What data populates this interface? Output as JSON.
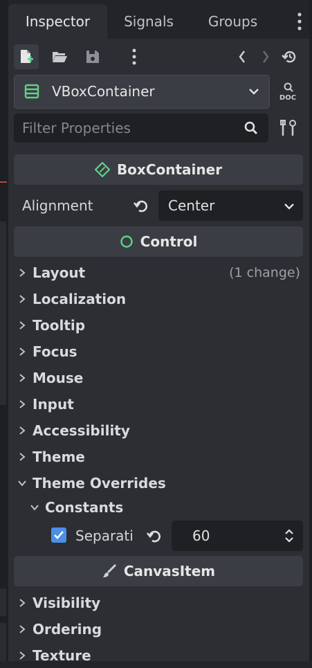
{
  "tabs": [
    {
      "label": "Inspector",
      "active": true
    },
    {
      "label": "Signals",
      "active": false
    },
    {
      "label": "Groups",
      "active": false
    }
  ],
  "toolbar": {
    "icons": [
      "new-resource-icon",
      "open-folder-icon",
      "save-icon",
      "more-vertical-icon",
      "history-back-icon",
      "history-forward-icon",
      "object-history-icon"
    ]
  },
  "class_selector": {
    "value": "VBoxContainer",
    "icon": "vbox-container-icon"
  },
  "doc_label": "DOC",
  "filter": {
    "placeholder": "Filter Properties"
  },
  "sections": {
    "box_container": {
      "label": "BoxContainer",
      "icon": "box-container-icon"
    },
    "control": {
      "label": "Control",
      "icon": "control-circle-icon"
    },
    "canvas_item": {
      "label": "CanvasItem",
      "icon": "brush-icon"
    }
  },
  "alignment": {
    "label": "Alignment",
    "value": "Center"
  },
  "groups_control": [
    {
      "label": "Layout",
      "extra": "(1 change)"
    },
    {
      "label": "Localization"
    },
    {
      "label": "Tooltip"
    },
    {
      "label": "Focus"
    },
    {
      "label": "Mouse"
    },
    {
      "label": "Input"
    },
    {
      "label": "Accessibility"
    },
    {
      "label": "Theme"
    },
    {
      "label": "Theme Overrides",
      "expanded": true
    }
  ],
  "constants": {
    "label": "Constants",
    "expanded": true
  },
  "separation": {
    "label": "Separati",
    "checked": true,
    "value": "60"
  },
  "groups_canvas": [
    {
      "label": "Visibility"
    },
    {
      "label": "Ordering"
    },
    {
      "label": "Texture"
    }
  ],
  "colors": {
    "accent_green": "#5fd388",
    "checkbox_blue": "#4d8ee8",
    "panel_bg": "#2c2e33",
    "section_bg": "#3a3d43",
    "field_bg": "#1e2024"
  }
}
